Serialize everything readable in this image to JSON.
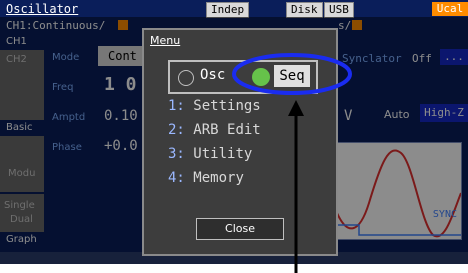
{
  "header": {
    "title": "Oscillator",
    "indep_label": "Indep",
    "disk_label": "Disk",
    "usb_label": "USB",
    "ucal_label": "Ucal"
  },
  "channel_bar": {
    "channel_text": "CH1:Continuous/",
    "right_text": "s/"
  },
  "sidebar": {
    "ch1": "CH1",
    "ch2": "CH2",
    "basic": "Basic",
    "modu": "Modu",
    "single": "Single",
    "dual": "Dual",
    "graph": "Graph"
  },
  "params": {
    "mode_label": "Mode",
    "mode_value": "Cont",
    "freq_label": "Freq",
    "freq_value": "1 0",
    "amptd_label": "Amptd",
    "amptd_value": "0.10",
    "phase_label": "Phase",
    "phase_value": "+0.0",
    "synclator_label": "Synclator",
    "synclator_value": "Off",
    "synclator_btn": "...",
    "v_label": "V",
    "auto_label": "Auto",
    "highz_label": "High-Z",
    "sync_label": "SYNC"
  },
  "menu": {
    "title": "Menu",
    "toggle": {
      "osc_label": "Osc",
      "seq_label": "Seq",
      "selected": "Seq"
    },
    "items": [
      {
        "num": "1:",
        "label": "Settings"
      },
      {
        "num": "2:",
        "label": "ARB Edit"
      },
      {
        "num": "3:",
        "label": "Utility"
      },
      {
        "num": "4:",
        "label": "Memory"
      }
    ],
    "close_label": "Close"
  },
  "colors": {
    "screen_bg": "#0a1e5a",
    "accent_orange": "#ff8c00",
    "highlight_blue": "#1428c8",
    "seq_green": "#66c24a"
  }
}
